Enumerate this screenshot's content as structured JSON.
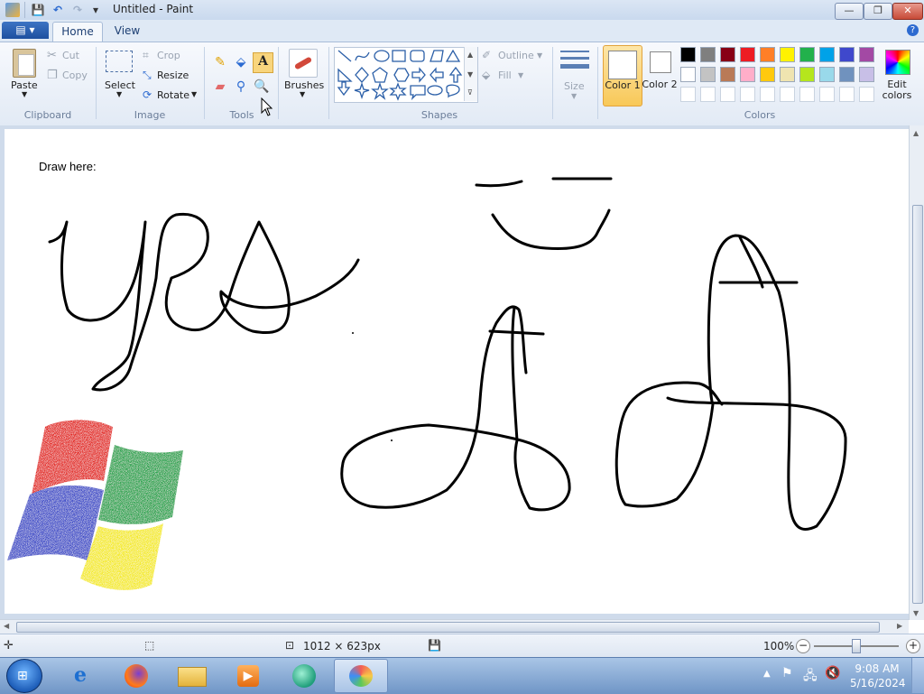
{
  "window": {
    "title": "Untitled - Paint",
    "minimize": "—",
    "maximize": "❐",
    "close": "✕"
  },
  "quick_access": {
    "save": "💾",
    "undo": "↶",
    "redo": "↷",
    "customize": "▾"
  },
  "tabs": {
    "file": "▤ ▾",
    "home": "Home",
    "view": "View",
    "help": "?"
  },
  "clipboard": {
    "paste": "Paste",
    "cut": "Cut",
    "copy": "Copy",
    "group": "Clipboard"
  },
  "image": {
    "select": "Select",
    "crop": "Crop",
    "resize": "Resize",
    "rotate": "Rotate",
    "group": "Image"
  },
  "tools": {
    "group": "Tools"
  },
  "brushes": {
    "label": "Brushes"
  },
  "shapes": {
    "outline": "Outline",
    "fill": "Fill",
    "group": "Shapes"
  },
  "size": {
    "label": "Size"
  },
  "colors": {
    "color1": "Color 1",
    "color2": "Color 2",
    "edit": "Edit colors",
    "group": "Colors",
    "color1_value": "#ffffff",
    "color2_value": "#ffffff",
    "palette_row1": [
      "#000000",
      "#7f7f7f",
      "#880015",
      "#ed1c24",
      "#ff7f27",
      "#fff200",
      "#22b14c",
      "#00a2e8",
      "#3f48cc",
      "#a349a4"
    ],
    "palette_row2": [
      "#ffffff",
      "#c3c3c3",
      "#b97a57",
      "#ffaec9",
      "#ffc90e",
      "#efe4b0",
      "#b5e61d",
      "#99d9ea",
      "#7092be",
      "#c8bfe7"
    ]
  },
  "canvas": {
    "text": "Draw here:"
  },
  "status": {
    "dimensions": "1012 × 623px",
    "zoom": "100%"
  },
  "clock": {
    "time": "9:08 AM",
    "date": "5/16/2024"
  }
}
